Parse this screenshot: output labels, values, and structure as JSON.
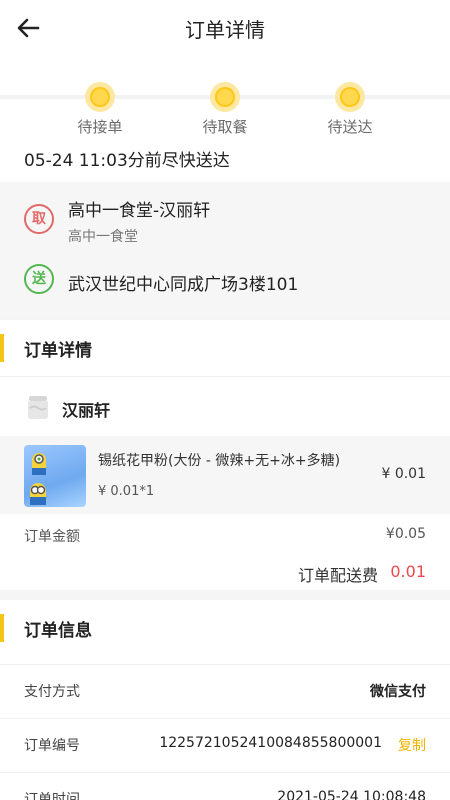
{
  "header": {
    "title": "订单详情"
  },
  "steps": [
    {
      "label": "待接单"
    },
    {
      "label": "待取餐"
    },
    {
      "label": "待送达"
    }
  ],
  "eta": "05-24 11:03分前尽快送达",
  "pickup": {
    "badge": "取",
    "name": "高中一食堂-汉丽轩",
    "sub": "高中一食堂"
  },
  "delivery": {
    "badge": "送",
    "address": "武汉世纪中心同成广场3楼101"
  },
  "order_detail": {
    "section_title": "订单详情",
    "shop_name": "汉丽轩",
    "item": {
      "name": "锡纸花甲粉(大份 - 微辣+无+冰+多糖)",
      "qty": "¥ 0.01*1",
      "price": "¥ 0.01"
    },
    "amount_label": "订单金额",
    "amount_value": "¥0.05",
    "fee_label": "订单配送费",
    "fee_value": "0.01"
  },
  "order_info": {
    "section_title": "订单信息",
    "rows": [
      {
        "label": "支付方式",
        "value": "微信支付"
      },
      {
        "label": "订单编号",
        "value": "1225721052410084855800001",
        "action": "复制"
      },
      {
        "label": "订单时间",
        "value": "2021-05-24 10:08:48"
      }
    ]
  },
  "colors": {
    "accent": "#f5c518",
    "pickup": "#e26a6a",
    "delivery": "#53b752",
    "fee": "#e84a4a",
    "copy": "#f0b400"
  }
}
